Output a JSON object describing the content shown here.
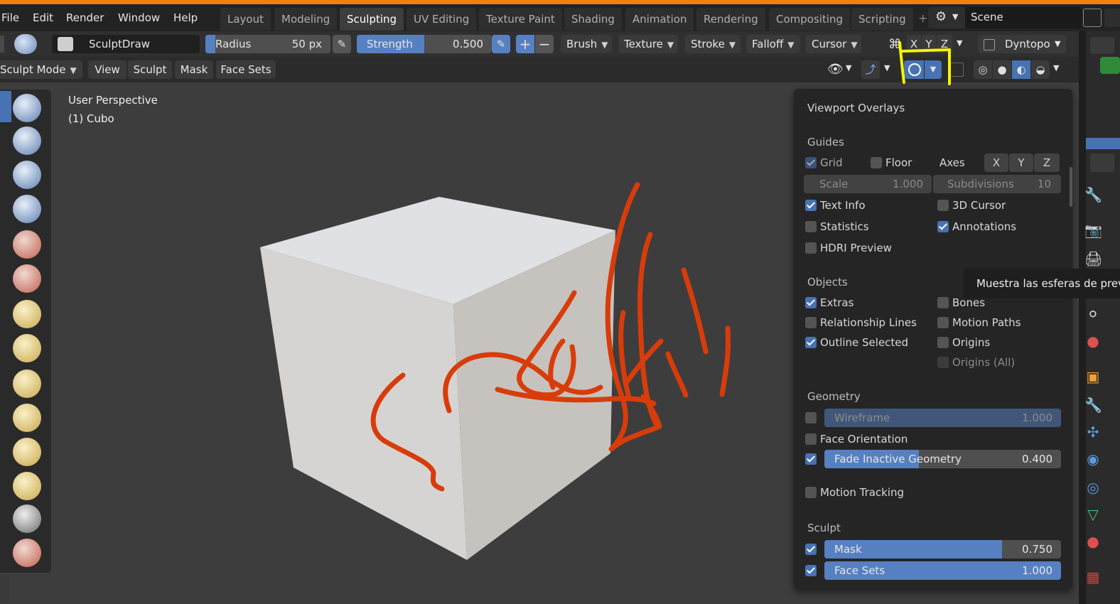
{
  "menu": [
    "File",
    "Edit",
    "Render",
    "Window",
    "Help"
  ],
  "workspace_tabs": [
    "Layout",
    "Modeling",
    "Sculpting",
    "UV Editing",
    "Texture Paint",
    "Shading",
    "Animation",
    "Rendering",
    "Compositing",
    "Scripting"
  ],
  "active_tab": "Sculpting",
  "scene": {
    "name": "Scene"
  },
  "toolbar": {
    "brush_name": "SculptDraw",
    "radius_label": "Radius",
    "radius_value": "50 px",
    "strength_label": "Strength",
    "strength_value": "0.500",
    "plus": "+",
    "minus": "−",
    "brush_menu": "Brush",
    "texture_menu": "Texture",
    "stroke_menu": "Stroke",
    "falloff_menu": "Falloff",
    "cursor_menu": "Cursor",
    "axis_x": "X",
    "axis_y": "Y",
    "axis_z": "Z",
    "dyntopo": "Dyntopo"
  },
  "header": {
    "mode": "Sculpt Mode",
    "view": "View",
    "sculpt": "Sculpt",
    "mask": "Mask",
    "face_sets": "Face Sets"
  },
  "viewport": {
    "perspective": "User Perspective",
    "object": "(1) Cubo"
  },
  "overlays": {
    "title": "Viewport Overlays",
    "guides": {
      "title": "Guides",
      "grid": {
        "label": "Grid",
        "checked": true
      },
      "floor": {
        "label": "Floor",
        "checked": false
      },
      "axes_label": "Axes",
      "axes": [
        "X",
        "Y",
        "Z"
      ],
      "scale_label": "Scale",
      "scale_value": "1.000",
      "subdivisions_label": "Subdivisions",
      "subdivisions_value": "10",
      "text_info": {
        "label": "Text Info",
        "checked": true
      },
      "cursor_3d": {
        "label": "3D Cursor",
        "checked": false
      },
      "statistics": {
        "label": "Statistics",
        "checked": false
      },
      "annotations": {
        "label": "Annotations",
        "checked": true
      },
      "hdri_preview": {
        "label": "HDRI Preview",
        "checked": false
      }
    },
    "objects": {
      "title": "Objects",
      "extras": {
        "label": "Extras",
        "checked": true
      },
      "bones": {
        "label": "Bones",
        "checked": false
      },
      "relationship_lines": {
        "label": "Relationship Lines",
        "checked": false
      },
      "motion_paths": {
        "label": "Motion Paths",
        "checked": false
      },
      "outline_selected": {
        "label": "Outline Selected",
        "checked": true
      },
      "origins": {
        "label": "Origins",
        "checked": false
      },
      "origins_all": {
        "label": "Origins (All)",
        "checked": false
      }
    },
    "geometry": {
      "title": "Geometry",
      "wireframe": {
        "label": "Wireframe",
        "value": "1.000",
        "checked": false,
        "fraction": 1.0
      },
      "face_orientation": {
        "label": "Face Orientation",
        "checked": false
      },
      "fade_inactive": {
        "label": "Fade Inactive Geometry",
        "value": "0.400",
        "checked": true,
        "fraction": 0.4
      }
    },
    "motion_tracking": {
      "label": "Motion Tracking",
      "checked": false
    },
    "sculpt": {
      "title": "Sculpt",
      "mask": {
        "label": "Mask",
        "value": "0.750",
        "checked": true,
        "fraction": 0.75
      },
      "face_sets": {
        "label": "Face Sets",
        "value": "1.000",
        "checked": true,
        "fraction": 1.0
      }
    }
  },
  "tooltip": "Muestra las esferas de prev",
  "colors": {
    "accent_blue": "#4772b3",
    "annotation_stroke": "#d83c0a",
    "highlight_yellow": "#f5f500",
    "top_bar_orange": "#f08010"
  }
}
